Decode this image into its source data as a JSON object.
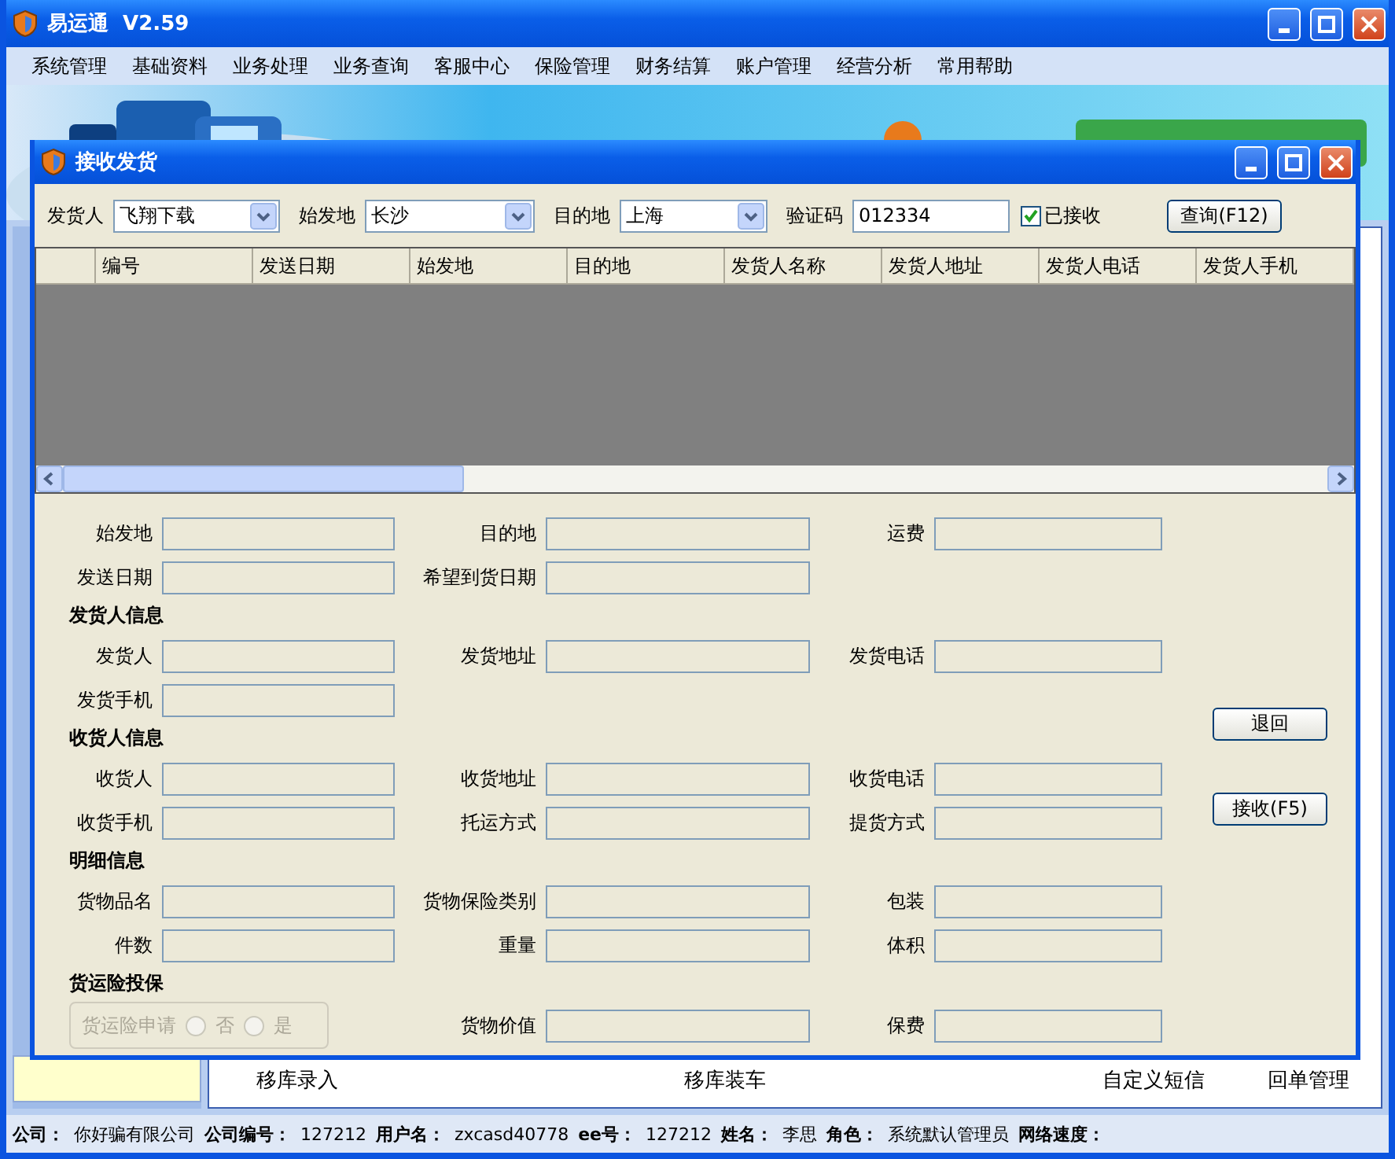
{
  "window": {
    "title": "易运通  V2.59"
  },
  "menu": [
    "系统管理",
    "基础资料",
    "业务处理",
    "业务查询",
    "客服中心",
    "保险管理",
    "财务结算",
    "账户管理",
    "经营分析",
    "常用帮助"
  ],
  "background_links": [
    "移库录入",
    "移库装车",
    "自定义短信",
    "回单管理"
  ],
  "dialog": {
    "title": "接收发货",
    "filters": [
      {
        "label": "发货人",
        "kind": "dropdown",
        "value": "飞翔下载"
      },
      {
        "label": "始发地",
        "kind": "dropdown",
        "value": "长沙"
      },
      {
        "label": "目的地",
        "kind": "dropdown",
        "value": "上海"
      },
      {
        "label": "验证码",
        "kind": "text",
        "value": "012334"
      }
    ],
    "received_checkbox": {
      "label": "已接收",
      "checked": true
    },
    "query_button": "查询(F12)",
    "table": {
      "columns": [
        "编号",
        "发送日期",
        "始发地",
        "目的地",
        "发货人名称",
        "发货人地址",
        "发货人电话",
        "发货人手机"
      ]
    },
    "form": [
      {
        "kind": "row",
        "fields": [
          {
            "kind": "field",
            "label": "始发地"
          },
          {
            "kind": "field",
            "label": "目的地"
          },
          {
            "kind": "field",
            "label": "运费"
          }
        ]
      },
      {
        "kind": "row",
        "fields": [
          {
            "kind": "field",
            "label": "发送日期"
          },
          {
            "kind": "field",
            "label": "希望到货日期"
          }
        ]
      },
      {
        "kind": "heading",
        "text": "发货人信息"
      },
      {
        "kind": "row",
        "fields": [
          {
            "kind": "field",
            "label": "发货人"
          },
          {
            "kind": "field",
            "label": "发货地址"
          },
          {
            "kind": "field",
            "label": "发货电话"
          }
        ]
      },
      {
        "kind": "row",
        "fields": [
          {
            "kind": "field",
            "label": "发货手机"
          }
        ]
      },
      {
        "kind": "heading",
        "text": "收货人信息"
      },
      {
        "kind": "row",
        "fields": [
          {
            "kind": "field",
            "label": "收货人"
          },
          {
            "kind": "field",
            "label": "收货地址"
          },
          {
            "kind": "field",
            "label": "收货电话"
          }
        ]
      },
      {
        "kind": "row",
        "fields": [
          {
            "kind": "field",
            "label": "收货手机"
          },
          {
            "kind": "field",
            "label": "托运方式"
          },
          {
            "kind": "field",
            "label": "提货方式"
          }
        ]
      },
      {
        "kind": "heading",
        "text": "明细信息"
      },
      {
        "kind": "row",
        "fields": [
          {
            "kind": "field",
            "label": "货物品名"
          },
          {
            "kind": "field",
            "label": "货物保险类别"
          },
          {
            "kind": "field",
            "label": "包装"
          }
        ]
      },
      {
        "kind": "row",
        "fields": [
          {
            "kind": "field",
            "label": "件数"
          },
          {
            "kind": "field",
            "label": "重量"
          },
          {
            "kind": "field",
            "label": "体积"
          }
        ]
      },
      {
        "kind": "heading",
        "text": "货运险投保"
      },
      {
        "kind": "row",
        "fields": [
          {
            "kind": "radio_group",
            "label": "货运险申请",
            "disabled": true,
            "options": [
              {
                "label": "否",
                "selected": false
              },
              {
                "label": "是",
                "selected": false
              }
            ]
          },
          {
            "kind": "field",
            "label": "货物价值"
          },
          {
            "kind": "field",
            "label": "保费"
          }
        ]
      }
    ],
    "buttons": [
      "退回",
      "接收(F5)"
    ]
  },
  "status_bar": [
    {
      "label": "公司：",
      "value": "你好骗有限公司"
    },
    {
      "label": "公司编号：",
      "value": "127212"
    },
    {
      "label": "用户名：",
      "value": "zxcasd40778"
    },
    {
      "label": "ee号：",
      "value": "127212"
    },
    {
      "label": "姓名：",
      "value": "李思"
    },
    {
      "label": "角色：",
      "value": "系统默认管理员"
    },
    {
      "label": "网络速度："
    }
  ]
}
